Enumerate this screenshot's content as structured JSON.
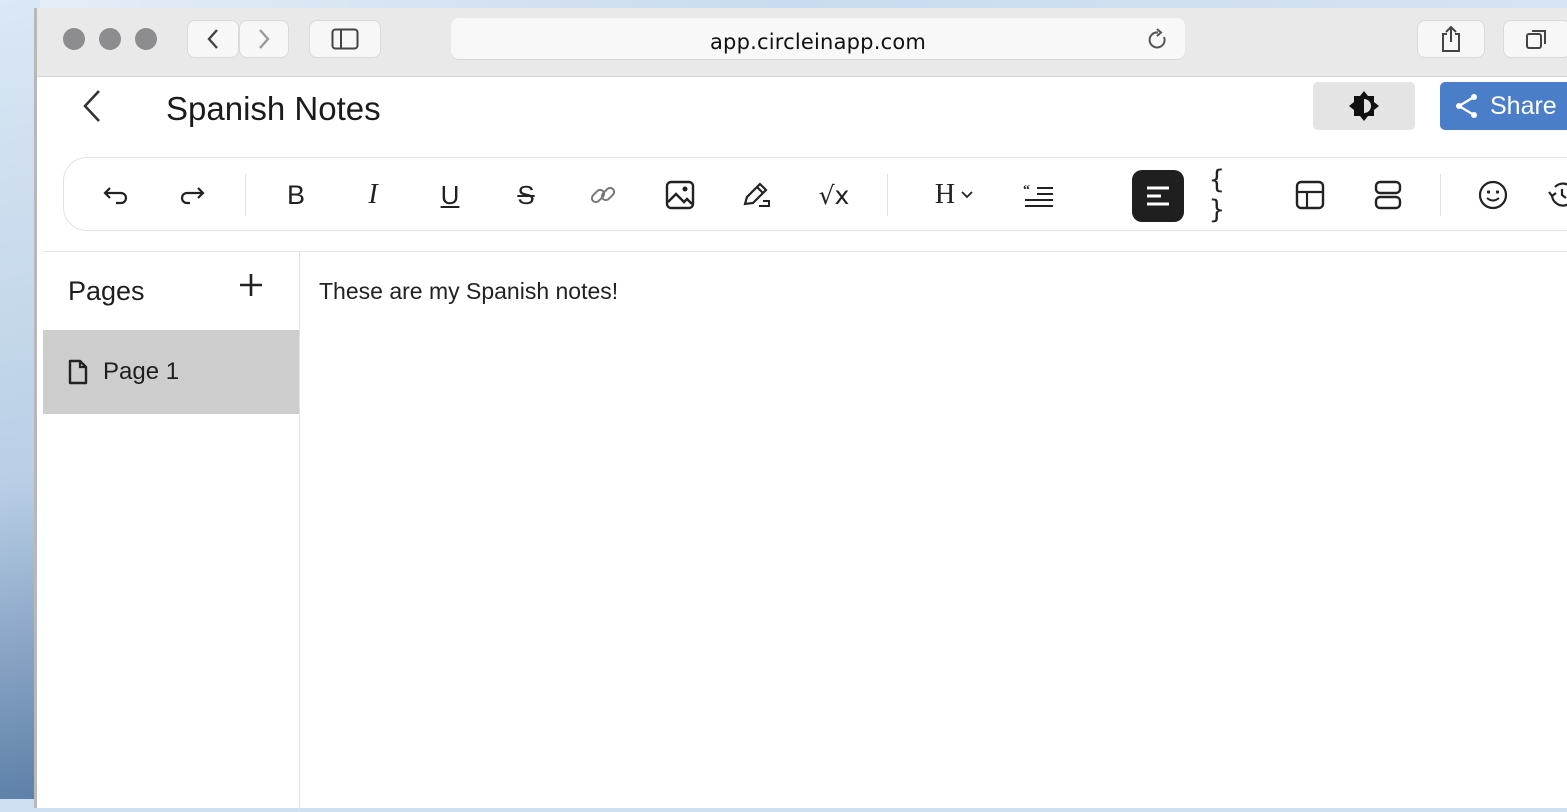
{
  "browser": {
    "url": "app.circleinapp.com",
    "icons": [
      "back-icon",
      "forward-icon",
      "sidebar-toggle-icon",
      "reload-icon",
      "share-sheet-icon",
      "tabs-icon"
    ]
  },
  "header": {
    "title": "Spanish Notes",
    "share_label": "Share"
  },
  "toolbar": {
    "tools": [
      "undo",
      "redo",
      "bold",
      "italic",
      "underline",
      "strikethrough",
      "link",
      "image",
      "draw",
      "math",
      "heading",
      "blockquote",
      "align-left",
      "code-block",
      "table",
      "columns",
      "emoji",
      "history"
    ],
    "bold_glyph": "B",
    "italic_glyph": "I",
    "underline_glyph": "U",
    "strike_glyph": "S",
    "math_glyph": "√x",
    "heading_glyph": "H",
    "code_glyph": "{ }",
    "active_tool": "align-left"
  },
  "sidebar": {
    "title": "Pages",
    "pages": [
      {
        "label": "Page 1"
      }
    ]
  },
  "editor": {
    "text": "These are my Spanish notes!"
  },
  "colors": {
    "share_button": "#4a7ec9",
    "active_tool_bg": "#1f1f1f",
    "selected_page_bg": "#cdcdcd"
  }
}
